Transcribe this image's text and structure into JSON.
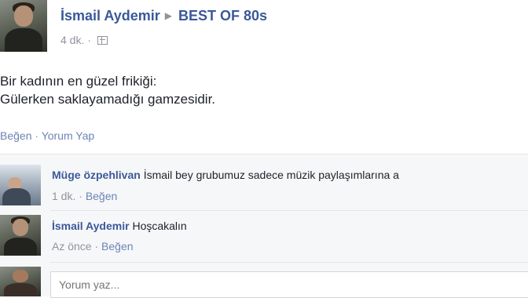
{
  "post": {
    "author": "İsmail Aydemir",
    "group": "BEST OF 80s",
    "time": "4 dk.",
    "text_line1": "Bir kadının en güzel frikiği:",
    "text_line2": "Gülerken saklayamadığı gamzesidir.",
    "like_label": "Beğen",
    "comment_label": "Yorum Yap"
  },
  "comments": [
    {
      "author": "Müge özpehlivan",
      "text": "İsmail bey grubumuz sadece müzik paylaşımlarına a",
      "time": "1 dk.",
      "like_label": "Beğen"
    },
    {
      "author": "İsmail Aydemir",
      "text": "Hoşcakalın",
      "time": "Az önce",
      "like_label": "Beğen"
    }
  ],
  "comment_box": {
    "placeholder": "Yorum yaz..."
  },
  "colors": {
    "link": "#3b5998",
    "action": "#6d84b4",
    "muted": "#90949c",
    "comment_bg": "#f6f7f9"
  }
}
